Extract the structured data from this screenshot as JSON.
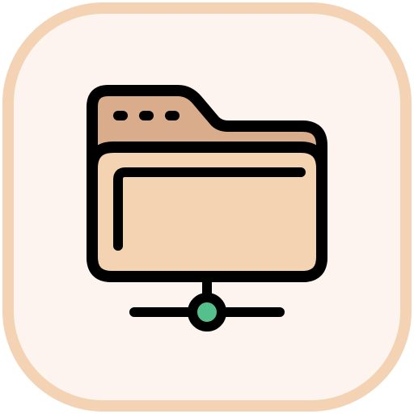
{
  "icon": {
    "name": "network-folder-icon",
    "parts": [
      "app-tile",
      "folder-icon",
      "network-node-icon"
    ]
  },
  "colors": {
    "tile_fill": "#fdf4ef",
    "tile_border": "#f3d3b4",
    "folder_back": "#d9ad8c",
    "folder_front": "#f4d3b3",
    "outline": "#000000",
    "node": "#56c08d"
  }
}
